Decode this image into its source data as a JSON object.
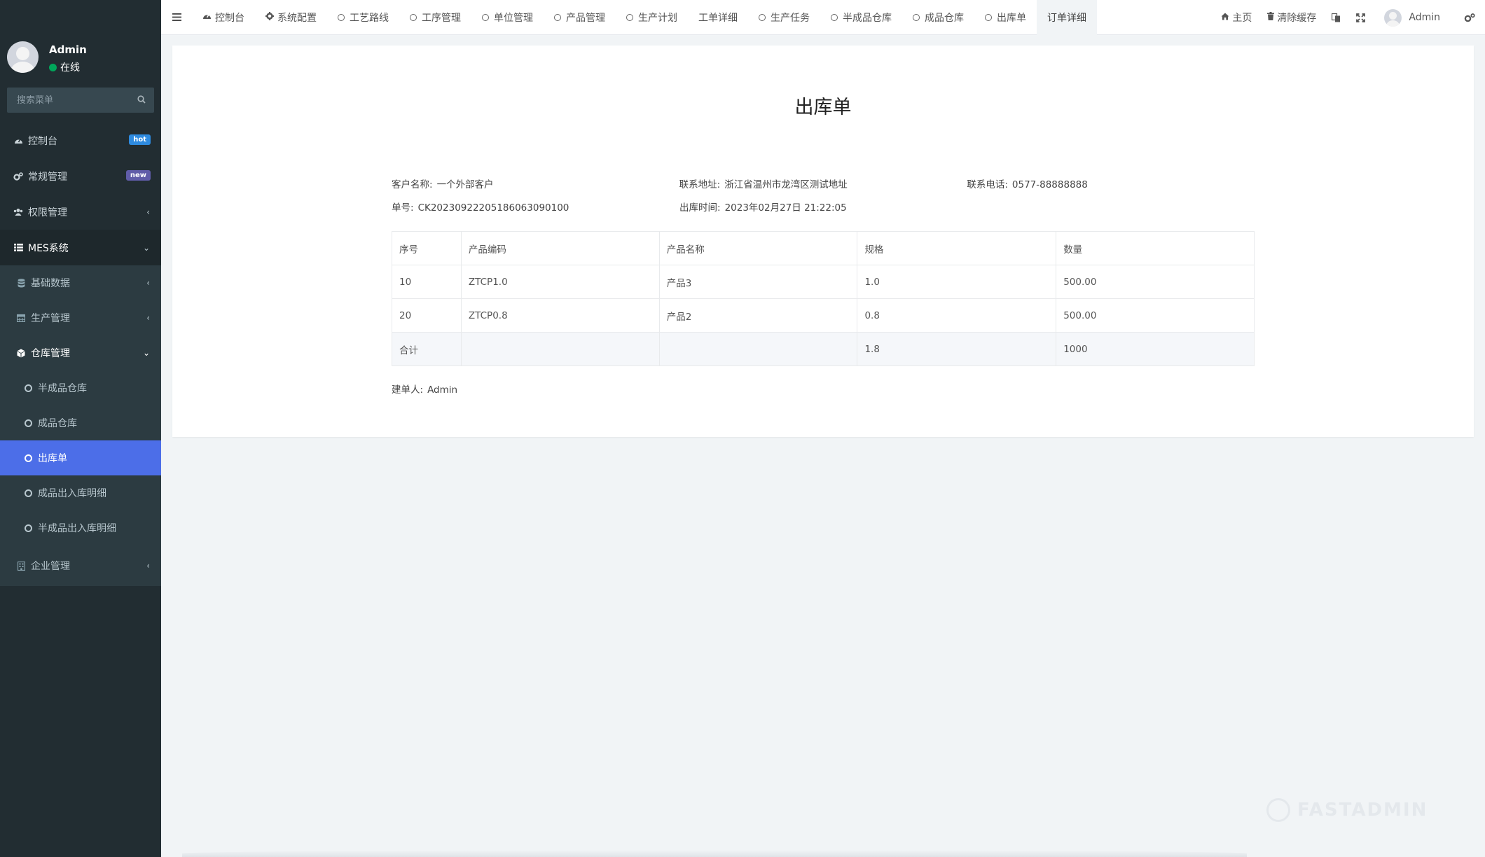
{
  "sidebar": {
    "user": {
      "name": "Admin",
      "status": "在线"
    },
    "search_placeholder": "搜索菜单",
    "items": [
      {
        "label": "控制台",
        "badge": "hot"
      },
      {
        "label": "常规管理",
        "badge": "new"
      },
      {
        "label": "权限管理"
      },
      {
        "label": "MES系统"
      }
    ],
    "mes_sub": [
      {
        "label": "基础数据"
      },
      {
        "label": "生产管理"
      },
      {
        "label": "仓库管理"
      }
    ],
    "warehouse_sub": [
      {
        "label": "半成品仓库"
      },
      {
        "label": "成品仓库"
      },
      {
        "label": "出库单"
      },
      {
        "label": "成品出入库明细"
      },
      {
        "label": "半成品出入库明细"
      }
    ],
    "enterprise": {
      "label": "企业管理"
    }
  },
  "topnav": {
    "tabs": [
      {
        "label": "控制台"
      },
      {
        "label": "系统配置"
      },
      {
        "label": "工艺路线"
      },
      {
        "label": "工序管理"
      },
      {
        "label": "单位管理"
      },
      {
        "label": "产品管理"
      },
      {
        "label": "生产计划"
      },
      {
        "label": "工单详细"
      },
      {
        "label": "生产任务"
      },
      {
        "label": "半成品仓库"
      },
      {
        "label": "成品仓库"
      },
      {
        "label": "出库单"
      },
      {
        "label": "订单详细"
      }
    ],
    "right": {
      "home": "主页",
      "clear_cache": "清除缓存",
      "user": "Admin"
    }
  },
  "document": {
    "title": "出库单",
    "customer_label": "客户名称:",
    "customer": "一个外部客户",
    "address_label": "联系地址:",
    "address": "浙江省温州市龙湾区测试地址",
    "phone_label": "联系电话:",
    "phone": "0577-88888888",
    "number_label": "单号:",
    "number": "CK20230922205186063090100",
    "time_label": "出库时间:",
    "time": "2023年02月27日 21:22:05",
    "table": {
      "headers": [
        "序号",
        "产品编码",
        "产品名称",
        "规格",
        "数量"
      ],
      "rows": [
        [
          "10",
          "ZTCP1.0",
          "产品3",
          "1.0",
          "500.00"
        ],
        [
          "20",
          "ZTCP0.8",
          "产品2",
          "0.8",
          "500.00"
        ]
      ],
      "total": [
        "合计",
        "",
        "",
        "1.8",
        "1000"
      ]
    },
    "creator_label": "建单人:",
    "creator": "Admin"
  },
  "watermark": "FASTADMIN"
}
